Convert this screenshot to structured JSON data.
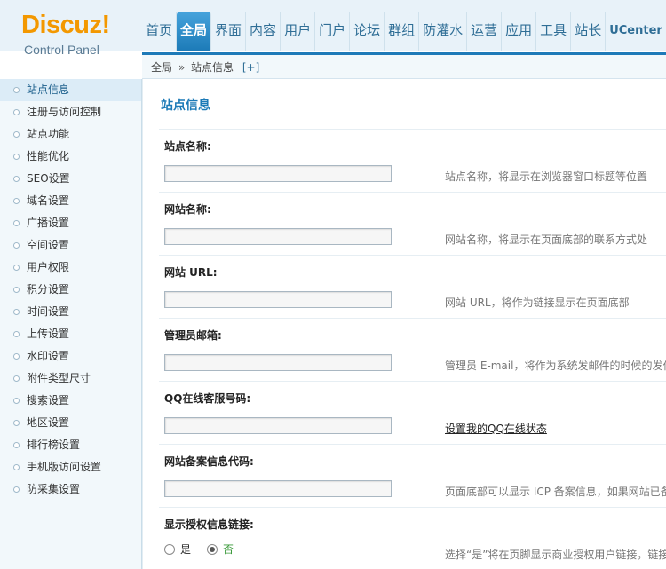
{
  "header": {
    "logo_name": "Discuz!",
    "logo_sub": "Control Panel",
    "nav": [
      "首页",
      "全局",
      "界面",
      "内容",
      "用户",
      "门户",
      "论坛",
      "群组",
      "防灌水",
      "运营",
      "应用",
      "工具",
      "站长",
      "UCenter"
    ],
    "active_nav": "全局"
  },
  "breadcrumb": {
    "root": "全局",
    "separator": "»",
    "current": "站点信息",
    "add": "[+]"
  },
  "sidebar": {
    "items": [
      "站点信息",
      "注册与访问控制",
      "站点功能",
      "性能优化",
      "SEO设置",
      "域名设置",
      "广播设置",
      "空间设置",
      "用户权限",
      "积分设置",
      "时间设置",
      "上传设置",
      "水印设置",
      "附件类型尺寸",
      "搜索设置",
      "地区设置",
      "排行榜设置",
      "手机版访问设置",
      "防采集设置"
    ],
    "active": "站点信息"
  },
  "main": {
    "title": "站点信息",
    "fields": [
      {
        "label": "站点名称:",
        "value": "",
        "tip": "站点名称，将显示在浏览器窗口标题等位置"
      },
      {
        "label": "网站名称:",
        "value": "",
        "tip": "网站名称，将显示在页面底部的联系方式处"
      },
      {
        "label": "网站 URL:",
        "value": "",
        "tip": "网站 URL，将作为链接显示在页面底部"
      },
      {
        "label": "管理员邮箱:",
        "value": "",
        "tip": "管理员 E-mail，将作为系统发邮件的时候的发件"
      },
      {
        "label": "QQ在线客服号码:",
        "value": "",
        "tip": "设置我的QQ在线状态"
      },
      {
        "label": "网站备案信息代码:",
        "value": "",
        "tip": "页面底部可以显示 ICP 备案信息，如果网站已备"
      }
    ],
    "license": {
      "label": "显示授权信息链接:",
      "option_yes": "是",
      "option_no": "否",
      "selected": "否",
      "tip": "选择“是”将在页脚显示商业授权用户链接，链接"
    }
  }
}
